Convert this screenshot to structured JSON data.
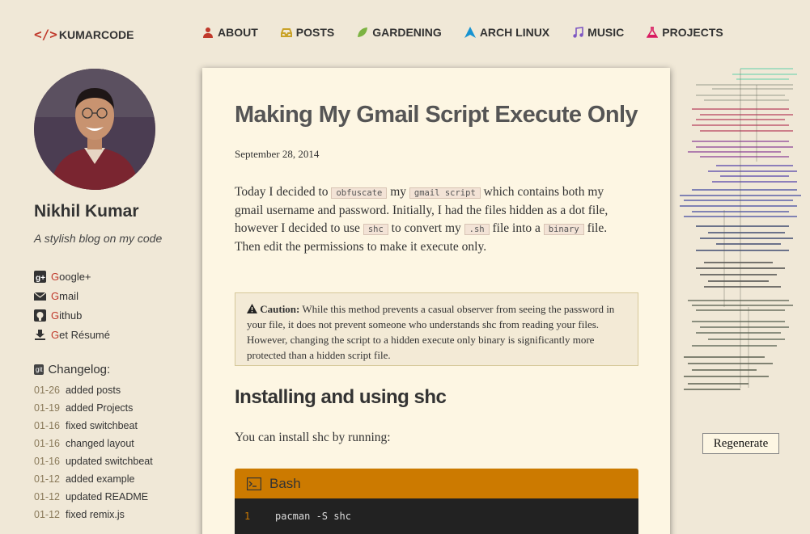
{
  "logo": {
    "mark": "</>",
    "text": "KUMARCODE"
  },
  "nav": [
    {
      "label": "ABOUT",
      "icon": "user-icon",
      "color": "#c0392b"
    },
    {
      "label": "POSTS",
      "icon": "inbox-icon",
      "color": "#c9a227"
    },
    {
      "label": "GARDENING",
      "icon": "leaf-icon",
      "color": "#7cb342"
    },
    {
      "label": "ARCH LINUX",
      "icon": "arch-icon",
      "color": "#1793d1"
    },
    {
      "label": "MUSIC",
      "icon": "music-icon",
      "color": "#7e57c2"
    },
    {
      "label": "PROJECTS",
      "icon": "flask-icon",
      "color": "#d81b60"
    }
  ],
  "sidebar": {
    "author": "Nikhil Kumar",
    "tagline": "A stylish blog on my code",
    "social": [
      {
        "first": "G",
        "rest": "oogle+",
        "icon": "google-plus-icon"
      },
      {
        "first": "G",
        "rest": "mail",
        "icon": "envelope-icon"
      },
      {
        "first": "G",
        "rest": "ithub",
        "icon": "github-icon"
      },
      {
        "first": "G",
        "rest": "et Résumé",
        "icon": "download-icon"
      }
    ],
    "changelog_title": "Changelog:",
    "git_label": "git",
    "changelog": [
      {
        "date": "01-26",
        "text": "added posts"
      },
      {
        "date": "01-19",
        "text": "added Projects"
      },
      {
        "date": "01-16",
        "text": "fixed switchbeat"
      },
      {
        "date": "01-16",
        "text": "changed layout"
      },
      {
        "date": "01-16",
        "text": "updated switchbeat"
      },
      {
        "date": "01-12",
        "text": "added example"
      },
      {
        "date": "01-12",
        "text": "updated README"
      },
      {
        "date": "01-12",
        "text": "fixed remix.js"
      }
    ]
  },
  "article": {
    "title": "Making My Gmail Script Execute Only",
    "date": "September 28, 2014",
    "para": {
      "t1": "Today I decided to ",
      "c1": "obfuscate",
      "t2": " my ",
      "c2": "gmail script",
      "t3": " which contains both my gmail username and password. Initially, I had the files hidden as a dot file, however I decided to use ",
      "c3": "shc",
      "t4": " to convert my ",
      "c4": ".sh",
      "t5": " file into a ",
      "c5": "binary",
      "t6": " file. Then edit the permissions to make it execute only."
    },
    "caution_label": "Caution:",
    "caution_text": " While this method prevents a casual observer from seeing the password in your file, it does not prevent someone who understands shc from reading your files. However, changing the script to a hidden execute only binary is significantly more protected than a hidden script file.",
    "h2": "Installing and using shc",
    "install_text": "You can install shc by running:",
    "code_lang": "Bash",
    "code_line_no": "1",
    "code_line": "pacman -S shc"
  },
  "regenerate_label": "Regenerate",
  "colors": {
    "accent": "#c0392b",
    "code_header": "#cc7a00",
    "background": "#f0e8d7",
    "card": "#fdf6e3"
  }
}
